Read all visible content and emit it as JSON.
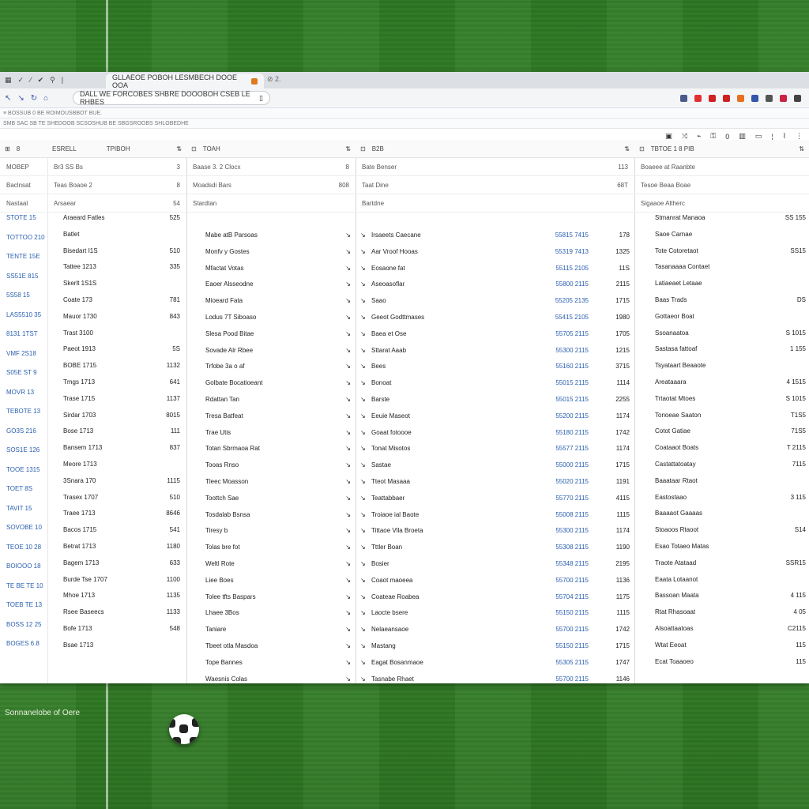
{
  "browser": {
    "tab_title": "GLLAEOE POBOH LESMBECH DOOE OOA",
    "tab_next": "⊘ 2.",
    "address": "DALL WE FORCOBES SHBRE DOOOBOH CSEB LE RHBES",
    "bookmarks": "≡ BOSSUB 0 BE ROIMOUSBBOT BUE.",
    "toolbar2_text": "SMB SAC SB TE SHEDOOB SCSOSHUB BE SBGSROOBS SHLOBEDHE",
    "ext_colors": [
      "#4a5a8a",
      "#e03030",
      "#d02020",
      "#cc2222",
      "#e87020",
      "#3355aa",
      "#555555",
      "#cc2244",
      "#444444"
    ]
  },
  "columns": {
    "col1": {
      "header_a": "⊞",
      "header_b": "8",
      "sub1_a": "MOBEP",
      "sub2_a": "Baclnsat",
      "sub3_a": "Nastaal",
      "rows": [
        "STOTE 15",
        "TOTTOO 210",
        "TENTE 15E",
        "SS51E 815",
        "5S58 15",
        "LAS5510 35",
        "8131 1TST",
        "VMF 2S18",
        "S05E ST 9",
        "MOVR 13",
        "TEBOTE 13",
        "GO3S 216",
        "SOS1E 126",
        "TOOE 1315",
        "TOET 8S",
        "TAVIT 15",
        "SOVOBE 10",
        "TEOE 10 28",
        "BOIOOO 18",
        "TE BE TE 10",
        "TOEB TE 13",
        "BOSS 12 25",
        "BOGES 6.8"
      ]
    },
    "col2": {
      "header_a": "ESRELL",
      "header_b": "TPIBOH",
      "sub1_a": "Br3 SS Bs",
      "sub1_b": "3",
      "sub2_a": "Teas Boaoe 2",
      "sub2_b": "8",
      "sub3_a": "Arsaear",
      "sub3_b": "54",
      "rows": [
        {
          "t": "Araeard Fatles",
          "n": "525"
        },
        {
          "t": "Batlet",
          "n": ""
        },
        {
          "t": "Bisedart I1S",
          "n": "510"
        },
        {
          "t": "Tattee 1213",
          "n": "335"
        },
        {
          "t": "Skerlt 1S1S",
          "n": ""
        },
        {
          "t": "Coate 173",
          "n": "781"
        },
        {
          "t": "Mauor 1730",
          "n": "843"
        },
        {
          "t": "Trast 3100",
          "n": ""
        },
        {
          "t": "Paeot 1913",
          "n": "5S"
        },
        {
          "t": "BOBE 1715",
          "n": "1132"
        },
        {
          "t": "Tmgs 1713",
          "n": "641"
        },
        {
          "t": "Trase 1715",
          "n": "1137"
        },
        {
          "t": "Sirdar 1703",
          "n": "8015"
        },
        {
          "t": "Bose 1713",
          "n": "111"
        },
        {
          "t": "Bansem 1713",
          "n": "837"
        },
        {
          "t": "Meore 1713",
          "n": ""
        },
        {
          "t": "3Snara 170",
          "n": "1115"
        },
        {
          "t": "Trasex 1707",
          "n": "510"
        },
        {
          "t": "Traee 1713",
          "n": "8646"
        },
        {
          "t": "Bacos 1715",
          "n": "541"
        },
        {
          "t": "Betrat 1713",
          "n": "1180"
        },
        {
          "t": "Bagem 1713",
          "n": "633"
        },
        {
          "t": "Burde Tse 1707",
          "n": "1100"
        },
        {
          "t": "Mhoe 1713",
          "n": "1135"
        },
        {
          "t": "Rsee Baseecs",
          "n": "1133"
        },
        {
          "t": "Bofe 1713",
          "n": "548"
        },
        {
          "t": "Bsae 1713",
          "n": ""
        }
      ]
    },
    "col3": {
      "header_a": "TOAH",
      "sub1_a": "Baase 3. 2 Clocx",
      "sub1_b": "8",
      "sub2_a": "Moadsdi Bars",
      "sub2_b": "808",
      "sub3_a": "Stardtan",
      "rows": [
        "Mabe atB Parsoas",
        "Monfv y Gostes",
        "Mfactat Votas",
        "Eaoer Alsseodne",
        "Mioeard Fata",
        "Lodus 7T Siboaso",
        "Slesa Pood Bitae",
        "Sovade Alr Rbee",
        "Trfobe 3a o af",
        "Golbate Bocatioeant",
        "Rdattan Tan",
        "Tresa Batfeat",
        "Trae Utis",
        "Totan Sbrmaoa Rat",
        "Tooas Rnso",
        "Tleec Moasson",
        "Toottch Sae",
        "Tosdalab Bsnsa",
        "Tiresy b",
        "Tolas bre fot",
        "Weltl Rote",
        "Liee Boes",
        "Tolee tfts Baspars",
        "Lhaee 3Bos",
        "Taniare",
        "Tbeet otla Masdoa",
        "Tope Bannes",
        "Waesnis Colas"
      ]
    },
    "col4": {
      "header_a": "B2B",
      "sub1_a": "Bate Benser",
      "sub1_b": "113",
      "sub2_a": "Taat Dine",
      "sub2_b": "68T",
      "sub3_a": "Bartdne",
      "rows": [
        {
          "t": "Irsaeets Caecane",
          "v": "55815 7415",
          "n": "178"
        },
        {
          "t": "Aar Vroof Hooas",
          "v": "55319 7413",
          "n": "1325"
        },
        {
          "t": "Eosaone fat",
          "v": "55115 2105",
          "n": "11S"
        },
        {
          "t": "Aseoasoflar",
          "v": "55800 2115",
          "n": "2115"
        },
        {
          "t": "Saao",
          "v": "55205 2135",
          "n": "1715"
        },
        {
          "t": "Geeot Godttmases",
          "v": "55415 2105",
          "n": "1980"
        },
        {
          "t": "Baea et Ose",
          "v": "55705 2115",
          "n": "1705"
        },
        {
          "t": "Sttarat Aaab",
          "v": "55300 2115",
          "n": "1215"
        },
        {
          "t": "Bees",
          "v": "55160 2115",
          "n": "3715"
        },
        {
          "t": "Bonoat",
          "v": "55015 2115",
          "n": "1114"
        },
        {
          "t": "Barste",
          "v": "55015 2115",
          "n": "2255"
        },
        {
          "t": "Eeuie Maseot",
          "v": "55200 2115",
          "n": "1174"
        },
        {
          "t": "Goaat fotoooe",
          "v": "55180 2115",
          "n": "1742"
        },
        {
          "t": "Tonat Misotos",
          "v": "55577 2115",
          "n": "1174"
        },
        {
          "t": "Sastae",
          "v": "55000 2115",
          "n": "1715"
        },
        {
          "t": "Tteot Masaaa",
          "v": "55020 2115",
          "n": "1191"
        },
        {
          "t": "Teattabbaer",
          "v": "55770 2115",
          "n": "4115"
        },
        {
          "t": "Troiaoe ial Baote",
          "v": "55008 2115",
          "n": "1115"
        },
        {
          "t": "Tittaoe Vlla Broeta",
          "v": "55300 2115",
          "n": "1174"
        },
        {
          "t": "Tttler Boan",
          "v": "55308 2115",
          "n": "1190"
        },
        {
          "t": "Bosier",
          "v": "55348 2115",
          "n": "2195"
        },
        {
          "t": "Coaot maoeea",
          "v": "55700 2115",
          "n": "1136"
        },
        {
          "t": "Coateae Roabea",
          "v": "55704 2115",
          "n": "1175"
        },
        {
          "t": "Laocte bsere",
          "v": "55150 2115",
          "n": "1115"
        },
        {
          "t": "Nelaeansaoe",
          "v": "55700 2115",
          "n": "1742"
        },
        {
          "t": "Mastang",
          "v": "55150 2115",
          "n": "1715"
        },
        {
          "t": "Eagat Bosanmaoe",
          "v": "55305 2115",
          "n": "1747"
        },
        {
          "t": "Tasnabe Rhaet",
          "v": "55700 2115",
          "n": "1146"
        }
      ]
    },
    "col5": {
      "header_a": "TBTOE 1 8 PIB",
      "sub1_a": "Boaeee at Raanbte",
      "sub2_a": "Tesoe Beaa Boae",
      "sub3_a": "Sigaaoe Altherc",
      "rows": [
        {
          "t": "Stmanrat Manaoa",
          "n": "SS 155"
        },
        {
          "t": "Saoe Carnae",
          "n": ""
        },
        {
          "t": "Tote Cotoretaot",
          "n": "SS15"
        },
        {
          "t": "Tasanaaaa Contaet",
          "n": ""
        },
        {
          "t": "Latiaeaet Letaae",
          "n": ""
        },
        {
          "t": "Baas Trads",
          "n": "DS"
        },
        {
          "t": "Gottaeor Boat",
          "n": ""
        },
        {
          "t": "Ssoanaatoa",
          "n": "S 1015"
        },
        {
          "t": "Sastasa fattoaf",
          "n": "1 155"
        },
        {
          "t": "Tsyataart Beaaote",
          "n": ""
        },
        {
          "t": "Areataaara",
          "n": "4 1515"
        },
        {
          "t": "Trtaotat Mtoes",
          "n": "S 1015"
        },
        {
          "t": "Tonoeae Saaton",
          "n": "T1S5"
        },
        {
          "t": "Cotot Gatiae",
          "n": "71S5"
        },
        {
          "t": "Coataaot Boats",
          "n": "T 2115"
        },
        {
          "t": "Castattatoatay",
          "n": "7115"
        },
        {
          "t": "Baaataar Rtaot",
          "n": ""
        },
        {
          "t": "Eastostaao",
          "n": "3 115"
        },
        {
          "t": "Baaaaot Gaaaas",
          "n": ""
        },
        {
          "t": "Stoaoos Rtaoot",
          "n": "S14"
        },
        {
          "t": "Esao Totaeo Matas",
          "n": ""
        },
        {
          "t": "Traote Atataad",
          "n": "SSR15"
        },
        {
          "t": "Eaata Lotaanot",
          "n": ""
        },
        {
          "t": "Bassoan Maata",
          "n": "4 115"
        },
        {
          "t": "Rtat Rhasoaat",
          "n": "4 05"
        },
        {
          "t": "Alsoattaatoas",
          "n": "C2115"
        },
        {
          "t": "Wtat Eeoat",
          "n": "115"
        },
        {
          "t": "Ecat Toaaoeo",
          "n": "115"
        }
      ]
    }
  },
  "caption": "Sonnanelobe of Oere"
}
